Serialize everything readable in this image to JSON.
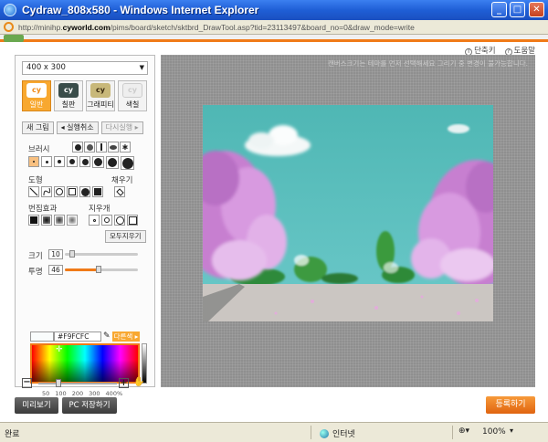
{
  "window": {
    "title": "Cydraw_808x580 - Windows Internet Explorer",
    "url_prefix": "http://minihp.",
    "url_domain": "cyworld.com",
    "url_rest": "/pims/board/sketch/sktbrd_DrawTool.asp?tid=23113497&board_no=0&draw_mode=write"
  },
  "header": {
    "shortcut_label": "단축키",
    "help_label": "도움말"
  },
  "panel": {
    "size_select": "400 x 300",
    "modes": [
      {
        "label": "일반",
        "logo": "cy"
      },
      {
        "label": "칠판",
        "logo": "cy"
      },
      {
        "label": "그래피티",
        "logo": "cy"
      },
      {
        "label": "색칠",
        "logo": "cy"
      }
    ],
    "actions": {
      "new": "새 그림",
      "undo": "◂ 실행취소",
      "redo": "다시실행 ▸"
    },
    "brush_label": "브러시",
    "shape_label": "도형",
    "fill_label": "채우기",
    "edge_label": "번짐효과",
    "eraser_label": "지우개",
    "erase_all": "모두지우기",
    "size_label": "크기",
    "size_value": "10",
    "size_level": 0.1,
    "opacity_label": "투명",
    "opacity_value": "46",
    "opacity_level": 0.46,
    "hex": "#F9FCFC",
    "more_colors": "다른색 ▸",
    "zoom_ticks": [
      "50",
      "100",
      "200",
      "300",
      "400%"
    ],
    "zoom_level": 0.25
  },
  "canvas": {
    "note": "캔버스크기는 테마를 먼저 선택해세요 그리기 중 변경이 불가능합니다."
  },
  "footer": {
    "preview": "미리보기",
    "save_pc": "PC 저장하기",
    "submit": "등록하기"
  },
  "status": {
    "left": "완료",
    "zone": "인터넷",
    "zoom": "100%"
  },
  "colors": {
    "accent": "#f07a18",
    "title": "#1f5fd6",
    "sky": "#4cb8b8",
    "blossom": "#d88ad8"
  }
}
